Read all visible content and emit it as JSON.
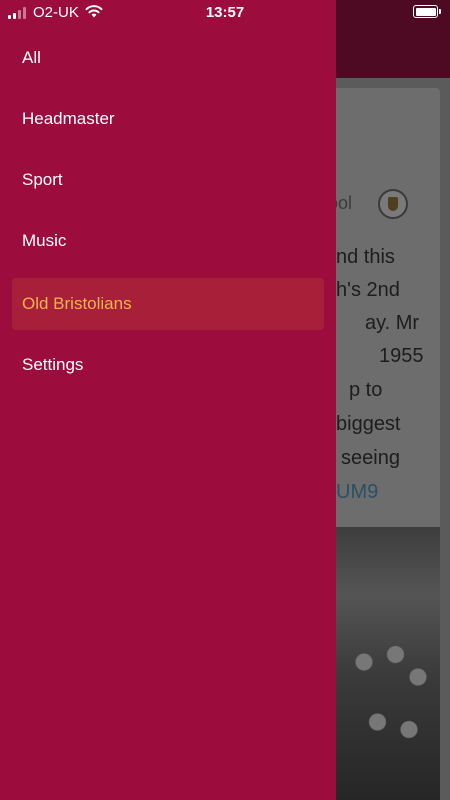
{
  "status_bar": {
    "carrier": "O2-UK",
    "time": "13:57"
  },
  "drawer": {
    "items": [
      {
        "label": "All",
        "active": false
      },
      {
        "label": "Headmaster",
        "active": false
      },
      {
        "label": "Sport",
        "active": false
      },
      {
        "label": "Music",
        "active": false
      },
      {
        "label": "Old Bristolians",
        "active": true
      },
      {
        "label": "Settings",
        "active": false
      }
    ],
    "active_color": "#f4b24a",
    "background_color": "#9c0c3d"
  },
  "background_post": {
    "author_partial": "hool",
    "text_lines": [
      "nd this",
      "h's 2nd",
      "ay. Mr",
      "1955",
      "p to",
      "biggest",
      "seeing"
    ],
    "link_partial": "UM9"
  }
}
